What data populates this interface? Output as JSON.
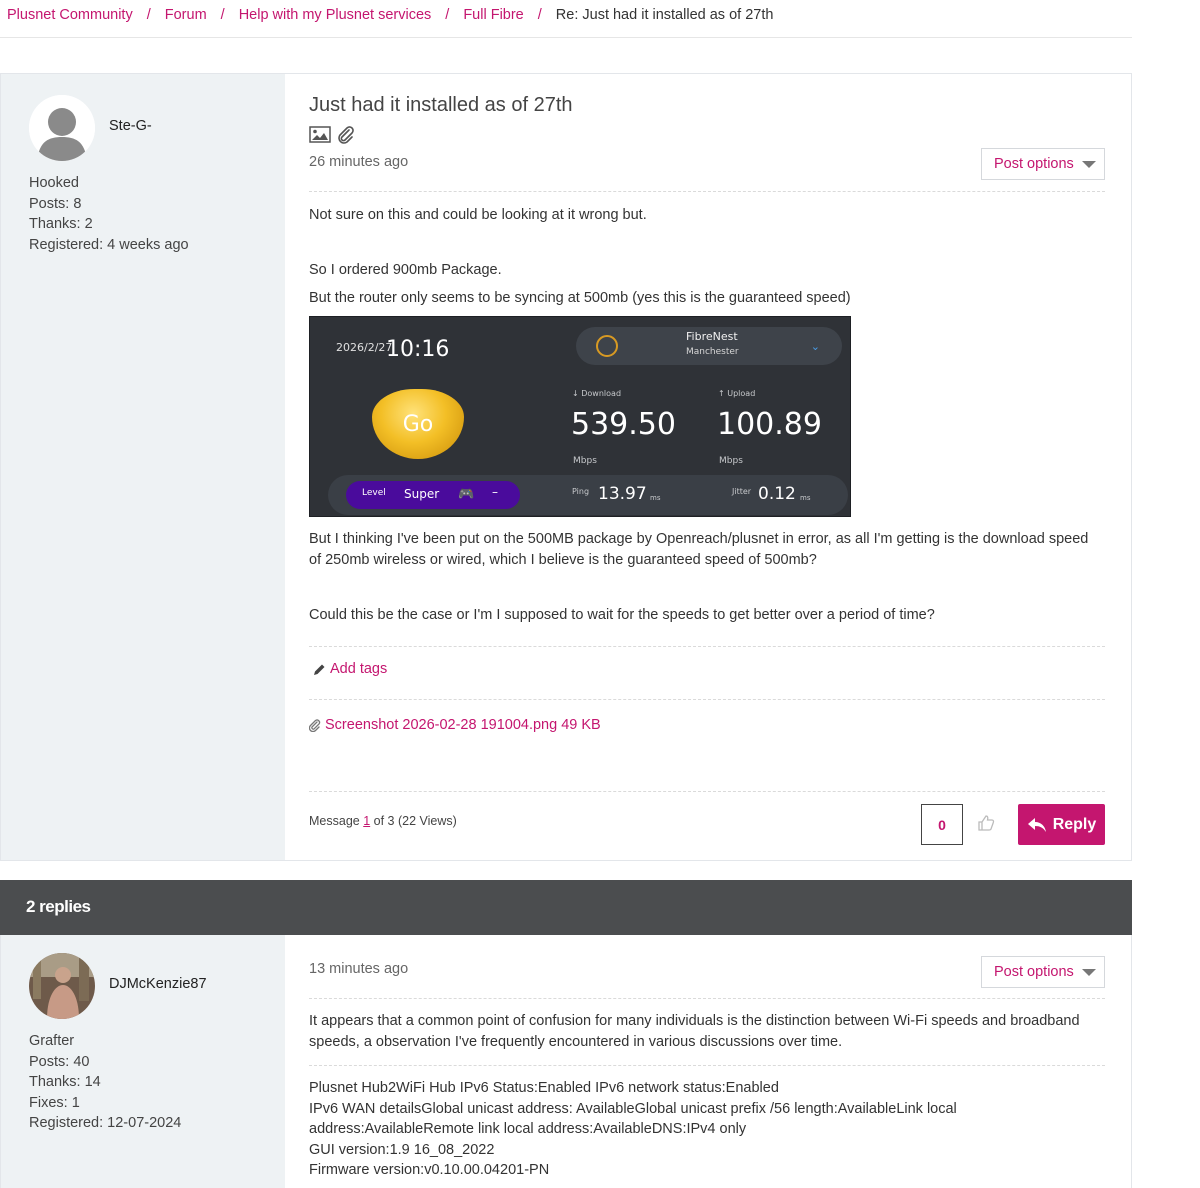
{
  "breadcrumb": {
    "items": [
      "Plusnet Community",
      "Forum",
      "Help with my Plusnet services",
      "Full Fibre"
    ],
    "current": "Re: Just had it installed as of 27th",
    "separator": "/"
  },
  "post1": {
    "author": {
      "name": "Ste-G-",
      "rank": "Hooked",
      "posts": "Posts: 8",
      "thanks": "Thanks: 2",
      "registered": "Registered: 4 weeks ago"
    },
    "title": "Just had it installed as of 27th",
    "time": "26 minutes ago",
    "post_options": "Post options",
    "paragraphs": {
      "p1": "Not sure on this and could be looking at it wrong but.",
      "p2": "So I ordered 900mb Package.",
      "p3": "But the router only seems to be syncing at 500mb (yes this is the guaranteed speed)",
      "p4": "But I thinking I've been put on the 500MB package by Openreach/plusnet in error, as all I'm getting is the download speed of 250mb wireless or wired, which I believe is the guaranteed speed of 500mb?",
      "p5": "Could this be the case or I'm I supposed to wait for the speeds to get better over a period of time?"
    },
    "speedtest": {
      "date": "2026/2/27",
      "time": "10:16",
      "server_name": "FibreNest",
      "server_city": "Manchester",
      "go_label": "Go",
      "download_label": "Download",
      "download_value": "539.50",
      "download_unit": "Mbps",
      "upload_label": "Upload",
      "upload_value": "100.89",
      "upload_unit": "Mbps",
      "level_label": "Level",
      "level_value": "Super",
      "level_dash": "–",
      "ping_label": "Ping",
      "ping_value": "13.97",
      "ping_unit": "ms",
      "jitter_label": "Jitter",
      "jitter_value": "0.12",
      "jitter_unit": "ms"
    },
    "add_tags": "Add tags",
    "attachment": "Screenshot 2026-02-28 191004.png 49 KB",
    "message_prefix": "Message",
    "message_number": "1",
    "message_suffix": "of 3 (22 Views)",
    "kudos": "0",
    "reply_label": "Reply"
  },
  "replies_header": "2 replies",
  "post2": {
    "author": {
      "name": "DJMcKenzie87",
      "rank": "Grafter",
      "posts": "Posts: 40",
      "thanks": "Thanks: 14",
      "fixes": "Fixes: 1",
      "registered": "Registered: 12-07-2024"
    },
    "time": "13 minutes ago",
    "post_options": "Post options",
    "body": "It appears that a common point of confusion for many individuals is the distinction between Wi-Fi speeds and broadband speeds, a observation I've frequently encountered in various discussions over time.",
    "signature": {
      "line1": "Plusnet Hub2WiFi Hub IPv6 Status:Enabled IPv6 network status:Enabled",
      "line2": "IPv6 WAN detailsGlobal unicast address: AvailableGlobal unicast prefix /56 length:AvailableLink local address:AvailableRemote link local address:AvailableDNS:IPv4 only",
      "line3": "GUI version:1.9 16_08_2022",
      "line4": "Firmware version:v0.10.00.04201-PN"
    }
  },
  "colors": {
    "accent": "#c4166f",
    "sidebar_bg": "#eef2f4",
    "replies_bar": "#4b4d4f"
  }
}
